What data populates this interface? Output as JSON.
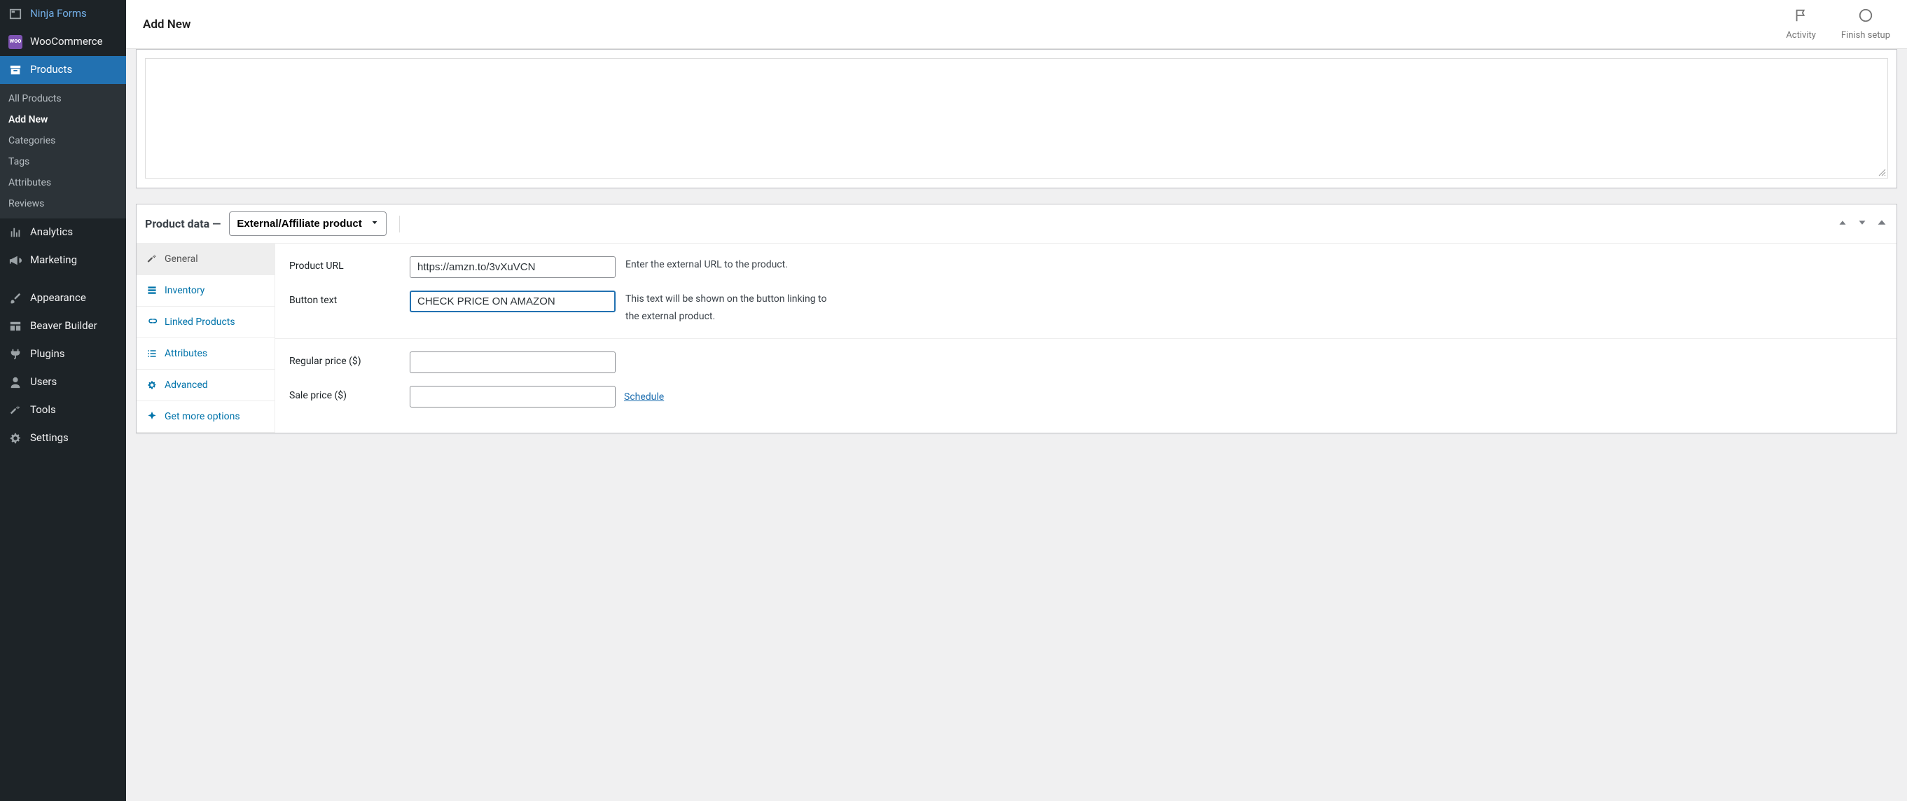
{
  "top": {
    "title": "Add New",
    "activity_label": "Activity",
    "finish_label": "Finish setup"
  },
  "sidebar": {
    "items": [
      {
        "label": "Ninja Forms"
      },
      {
        "label": "WooCommerce"
      },
      {
        "label": "Products"
      },
      {
        "label": "Analytics"
      },
      {
        "label": "Marketing"
      },
      {
        "label": "Appearance"
      },
      {
        "label": "Beaver Builder"
      },
      {
        "label": "Plugins"
      },
      {
        "label": "Users"
      },
      {
        "label": "Tools"
      },
      {
        "label": "Settings"
      }
    ],
    "submenu": [
      {
        "label": "All Products"
      },
      {
        "label": "Add New"
      },
      {
        "label": "Categories"
      },
      {
        "label": "Tags"
      },
      {
        "label": "Attributes"
      },
      {
        "label": "Reviews"
      }
    ]
  },
  "product_data": {
    "heading": "Product data —",
    "type_selected": "External/Affiliate product",
    "tabs": [
      {
        "label": "General"
      },
      {
        "label": "Inventory"
      },
      {
        "label": "Linked Products"
      },
      {
        "label": "Attributes"
      },
      {
        "label": "Advanced"
      },
      {
        "label": "Get more options"
      }
    ],
    "fields": {
      "product_url_label": "Product URL",
      "product_url_value": "https://amzn.to/3vXuVCN",
      "product_url_help": "Enter the external URL to the product.",
      "button_text_label": "Button text",
      "button_text_value": "CHECK PRICE ON AMAZON",
      "button_text_help": "This text will be shown on the button linking to the external product.",
      "regular_price_label": "Regular price ($)",
      "regular_price_value": "",
      "sale_price_label": "Sale price ($)",
      "sale_price_value": "",
      "schedule_label": "Schedule"
    }
  }
}
